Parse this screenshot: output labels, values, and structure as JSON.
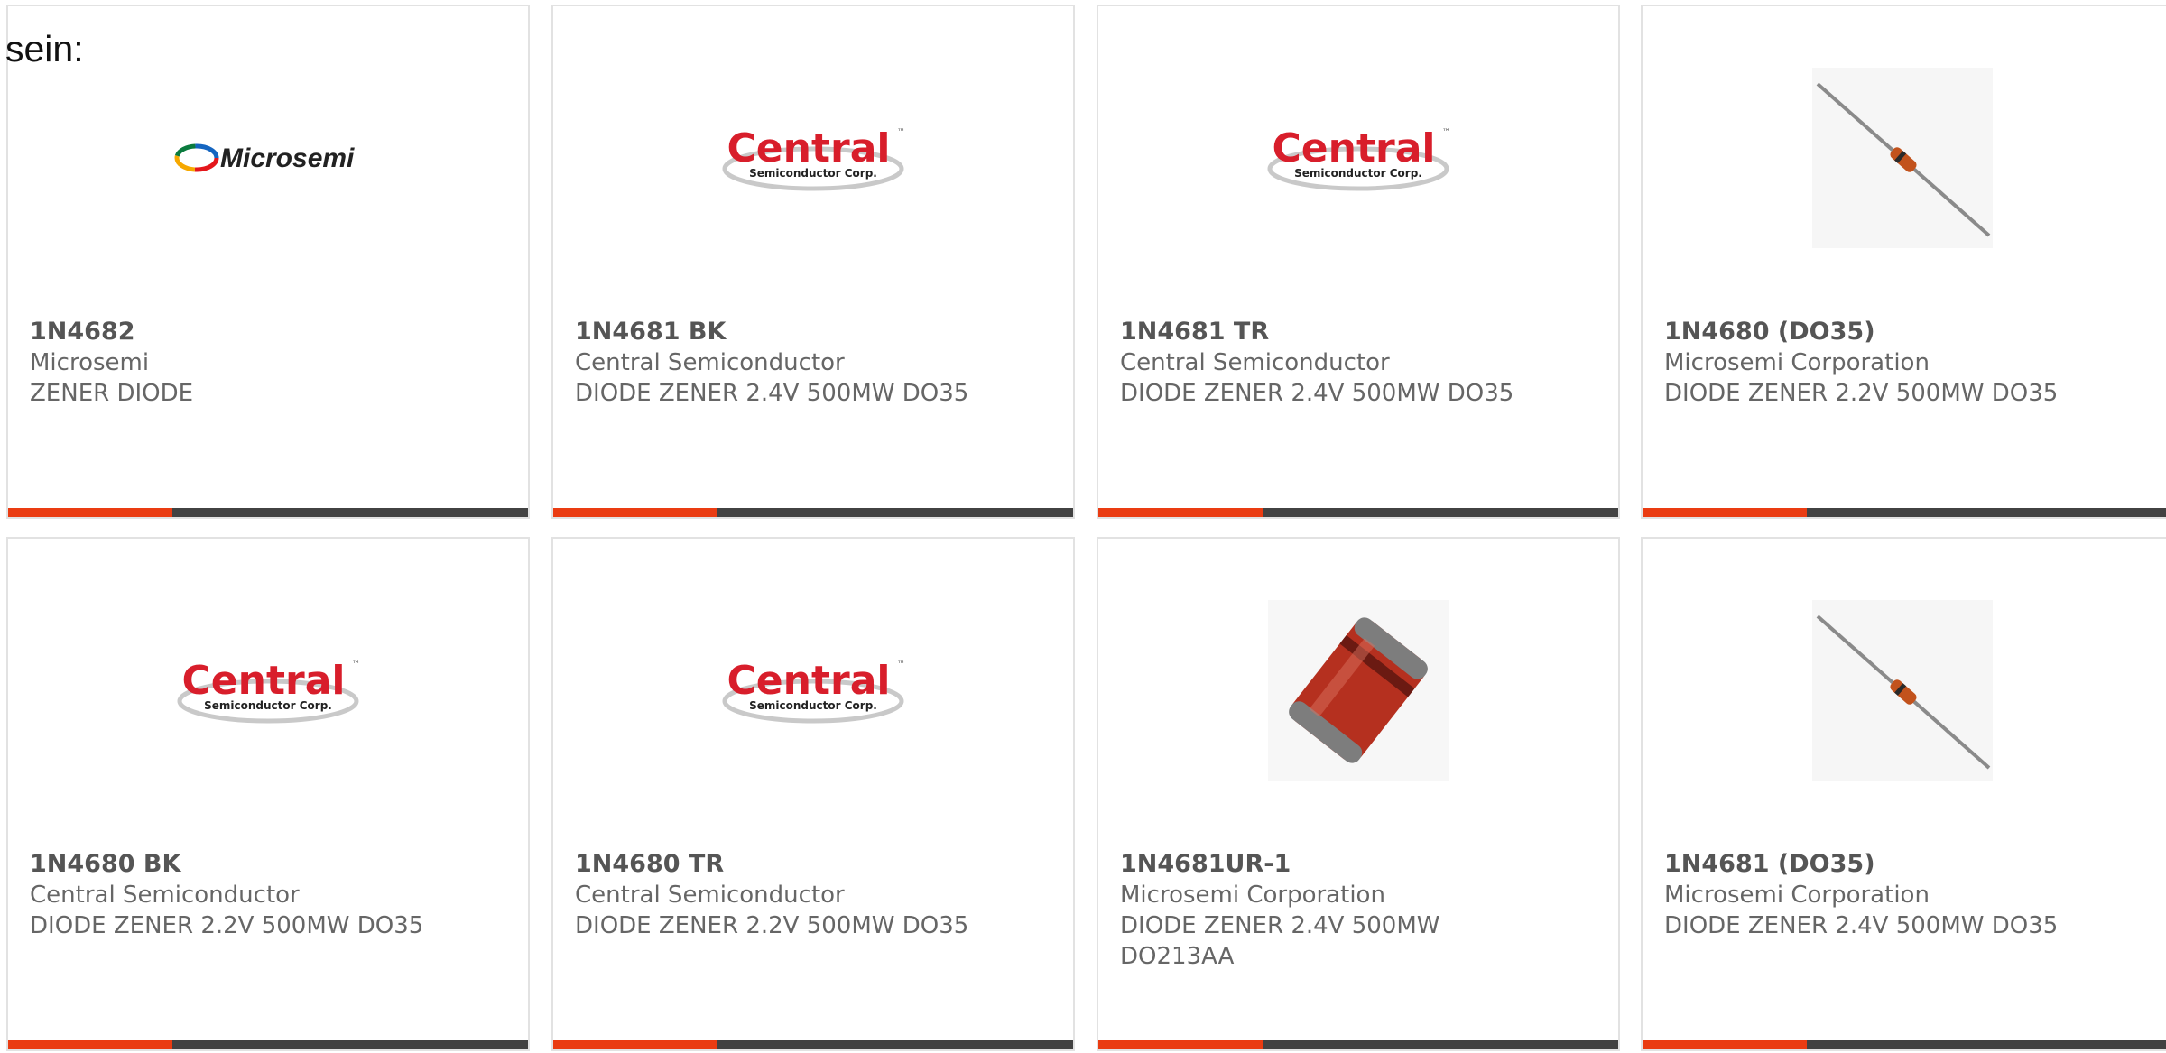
{
  "page_label": "sein:",
  "colors": {
    "accent": "#ea3c12",
    "bar": "#424242",
    "card_border": "#e2e2e2",
    "text": "#555555"
  },
  "logos": {
    "microsemi_text": "Microsemi",
    "central_main": "Central",
    "central_sub": "Semiconductor Corp.",
    "central_tm": "™"
  },
  "cards": [
    {
      "part_number": "1N4682",
      "manufacturer": "Microsemi",
      "description": "ZENER DIODE",
      "image": "microsemi-logo"
    },
    {
      "part_number": "1N4681 BK",
      "manufacturer": "Central Semiconductor",
      "description": "DIODE ZENER 2.4V 500MW DO35",
      "image": "central-logo"
    },
    {
      "part_number": "1N4681 TR",
      "manufacturer": "Central Semiconductor",
      "description": "DIODE ZENER 2.4V 500MW DO35",
      "image": "central-logo"
    },
    {
      "part_number": "1N4680 (DO35)",
      "manufacturer": "Microsemi Corporation",
      "description": "DIODE ZENER 2.2V 500MW DO35",
      "image": "axial-diode-photo"
    },
    {
      "part_number": "1N4680 BK",
      "manufacturer": "Central Semiconductor",
      "description": "DIODE ZENER 2.2V 500MW DO35",
      "image": "central-logo"
    },
    {
      "part_number": "1N4680 TR",
      "manufacturer": "Central Semiconductor",
      "description": "DIODE ZENER 2.2V 500MW DO35",
      "image": "central-logo"
    },
    {
      "part_number": "1N4681UR-1",
      "manufacturer": "Microsemi Corporation",
      "description": "DIODE ZENER 2.4V 500MW DO213AA",
      "image": "melf-diode-photo"
    },
    {
      "part_number": "1N4681 (DO35)",
      "manufacturer": "Microsemi Corporation",
      "description": "DIODE ZENER 2.4V 500MW DO35",
      "image": "axial-diode-photo"
    }
  ]
}
